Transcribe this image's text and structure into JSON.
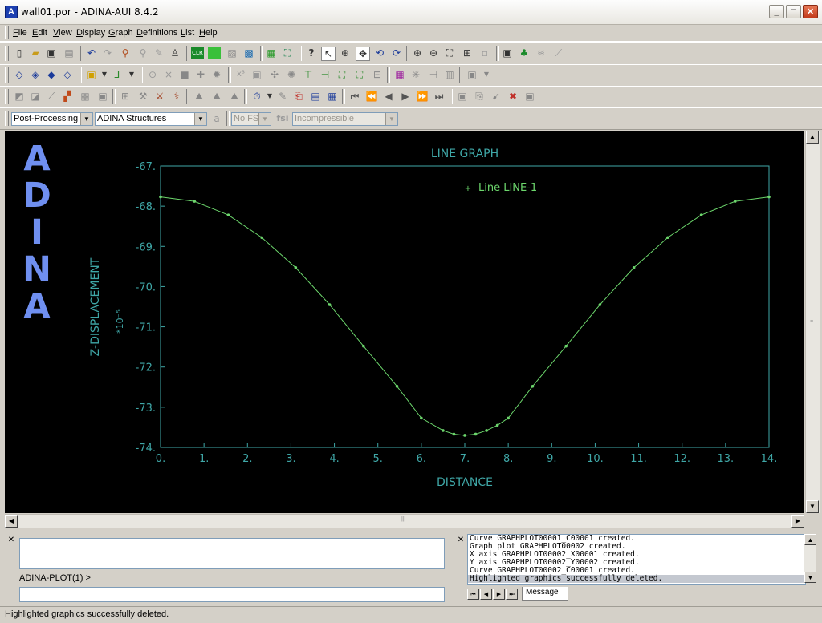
{
  "window": {
    "title": "wall01.por - ADINA-AUI  8.4.2",
    "logo_letter": "A",
    "controls": {
      "minimize": "_",
      "maximize": "□",
      "close": "✕"
    }
  },
  "menu": {
    "file": "File",
    "edit": "Edit",
    "view": "View",
    "display": "Display",
    "graph": "Graph",
    "definitions": "Definitions",
    "list": "List",
    "help": "Help"
  },
  "combos": {
    "mode": "Post-Processing",
    "program": "ADINA Structures",
    "fsi": "No FSI",
    "fsi_label": "fsi",
    "flow": "Incompressible"
  },
  "graphics": {
    "logo_letters": [
      "A",
      "D",
      "I",
      "N",
      "A"
    ],
    "accent_color": "#3fa7a7",
    "curve_color": "#6cd66c"
  },
  "chart_data": {
    "type": "line",
    "title": "LINE GRAPH",
    "xlabel": "DISTANCE",
    "ylabel": "Z-DISPLACEMENT",
    "yscale_note": "*10⁻⁵",
    "xlim": [
      0,
      14
    ],
    "ylim": [
      -74,
      -67
    ],
    "x_ticks": [
      "0.",
      "1.",
      "2.",
      "3.",
      "4.",
      "5.",
      "6.",
      "7.",
      "8.",
      "9.",
      "10.",
      "11.",
      "12.",
      "13.",
      "14."
    ],
    "y_ticks": [
      "-67.",
      "-68.",
      "-69.",
      "-70.",
      "-71.",
      "-72.",
      "-73.",
      "-74."
    ],
    "series": [
      {
        "name": "Line LINE-1",
        "x": [
          0,
          0.78,
          1.56,
          2.33,
          3.11,
          3.89,
          4.67,
          5.44,
          6.0,
          6.5,
          6.75,
          7.0,
          7.25,
          7.5,
          7.75,
          8.0,
          8.56,
          9.33,
          10.11,
          10.89,
          11.67,
          12.44,
          13.22,
          14.0
        ],
        "y": [
          -67.77,
          -67.88,
          -68.22,
          -68.78,
          -69.53,
          -70.45,
          -71.48,
          -72.48,
          -73.27,
          -73.58,
          -73.67,
          -73.7,
          -73.67,
          -73.58,
          -73.45,
          -73.27,
          -72.48,
          -71.48,
          -70.45,
          -69.53,
          -68.78,
          -68.22,
          -67.88,
          -67.77
        ]
      }
    ]
  },
  "console": {
    "prompt": "ADINA-PLOT(1) >",
    "messages": [
      "Curve GRAPHPLOT00001_C00001 created.",
      "Graph plot GRAPHPLOT00002 created.",
      "X axis GRAPHPLOT00002_X00001 created.",
      "Y axis GRAPHPLOT00002_Y00002 created.",
      "Curve GRAPHPLOT00002_C00001 created.",
      "Highlighted graphics successfully deleted."
    ],
    "message_tab": "Message"
  },
  "status": "Highlighted graphics successfully deleted."
}
